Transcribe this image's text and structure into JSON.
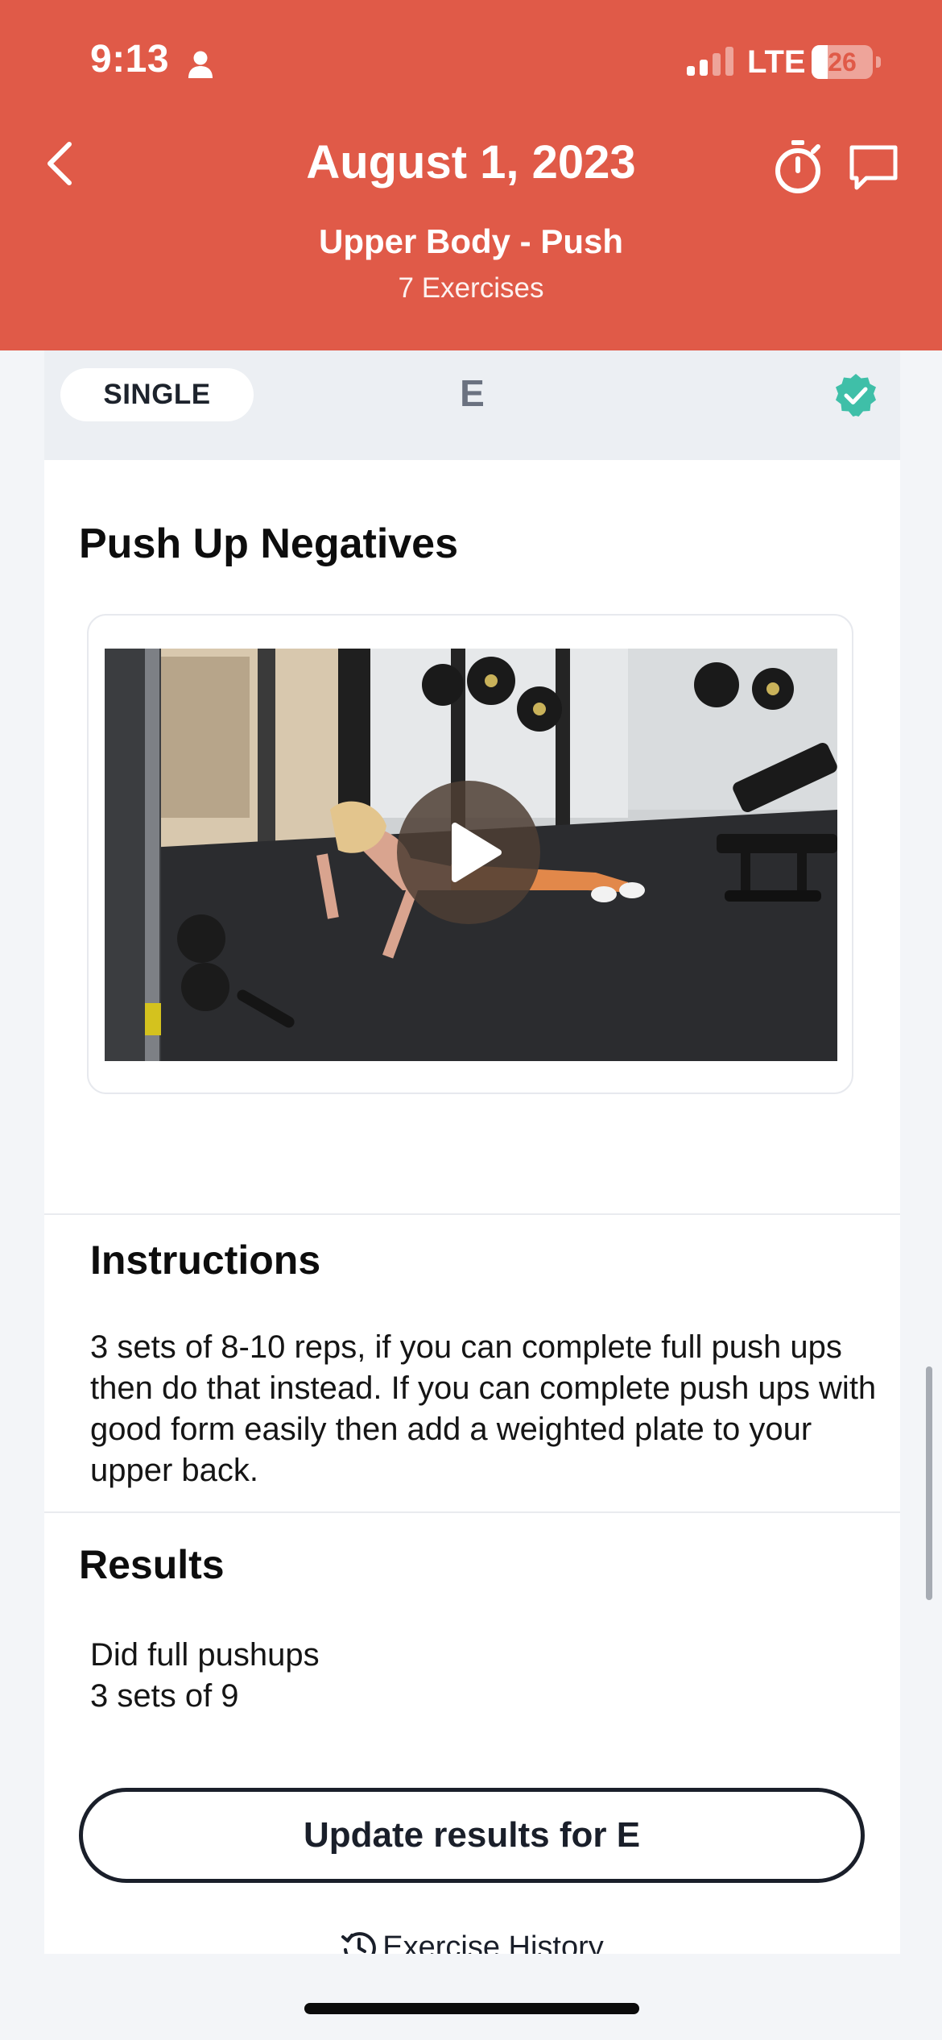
{
  "status_bar": {
    "time": "9:13",
    "network": "LTE",
    "battery": "26",
    "battery_fraction": 0.26,
    "person_icon": "person-icon",
    "signal_icon": "signal-bars-icon",
    "battery_icon": "battery-icon"
  },
  "header": {
    "date": "August 1, 2023",
    "workout_title": "Upper Body - Push",
    "exercise_count": "7 Exercises",
    "back_icon": "chevron-left-icon",
    "timer_icon": "stopwatch-icon",
    "chat_icon": "chat-bubble-icon",
    "background_color": "#e05a48"
  },
  "block": {
    "type_label": "SINGLE",
    "letter": "E",
    "complete_icon": "verified-check-icon",
    "complete_color": "#3fbfa8"
  },
  "exercise": {
    "name": "Push Up Negatives",
    "play_icon": "play-icon"
  },
  "instructions": {
    "heading": "Instructions",
    "text": "3 sets of 8-10 reps, if you can complete full push ups then do that instead. If you can complete push ups with good form easily then add a weighted plate to your upper back."
  },
  "results": {
    "heading": "Results",
    "lines": [
      "Did full pushups",
      "3 sets of 9"
    ]
  },
  "actions": {
    "update_button": "Update results for E",
    "history_link": "Exercise History",
    "history_icon": "history-clock-icon"
  }
}
